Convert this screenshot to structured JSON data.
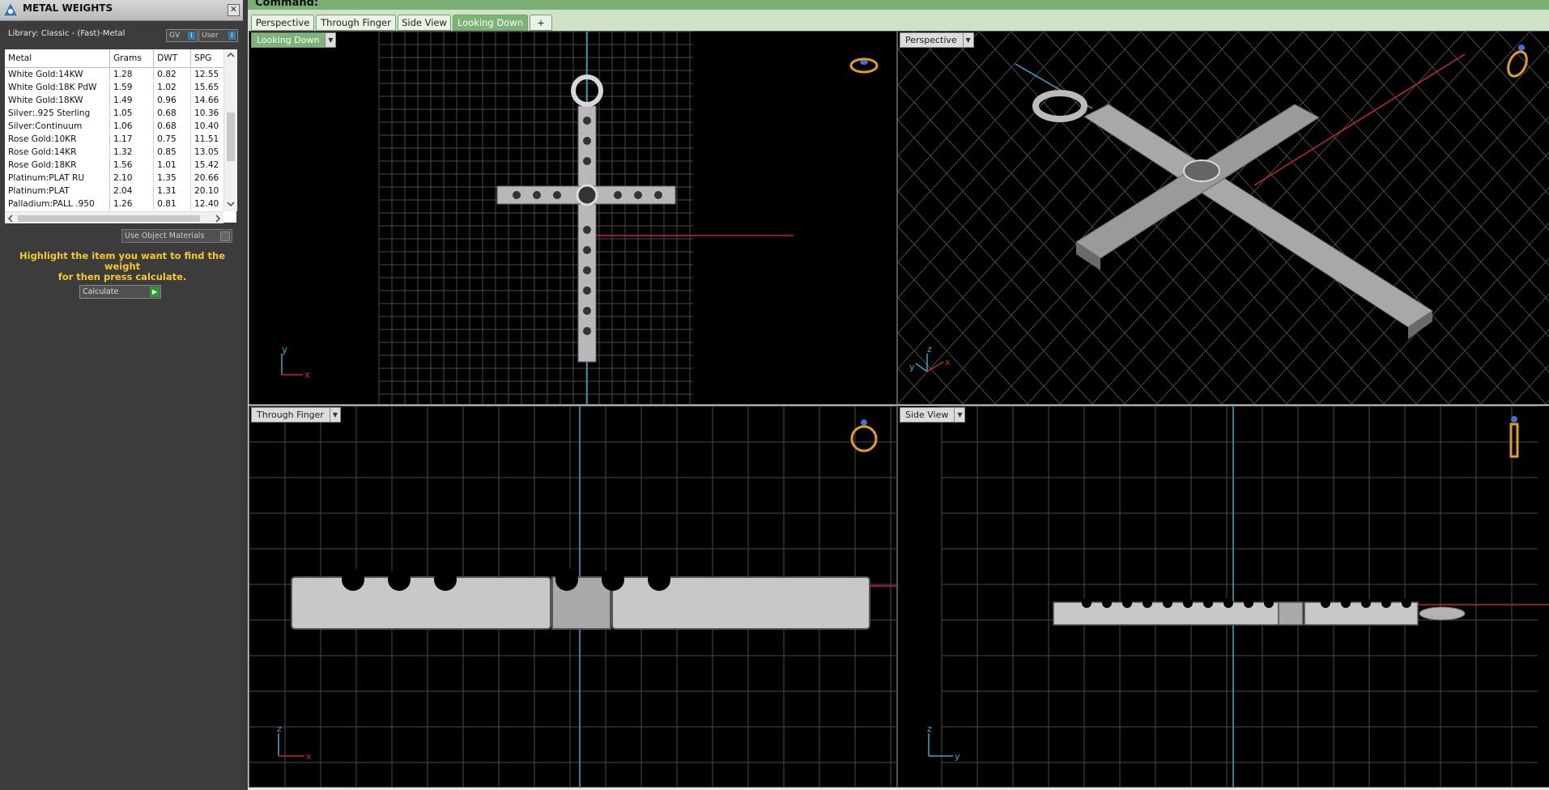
{
  "panel": {
    "title": "METAL WEIGHTS",
    "close": "✕",
    "library": "Library: Classic - (Fast)-Metal",
    "toggle_gv": "GV",
    "toggle_user": "User",
    "toggle_info": "i",
    "columns": [
      "Metal",
      "Grams",
      "DWT",
      "SPG"
    ],
    "rows": [
      [
        "White Gold:14KW",
        "1.28",
        "0.82",
        "12.55"
      ],
      [
        "White Gold:18K PdW",
        "1.59",
        "1.02",
        "15.65"
      ],
      [
        "White Gold:18KW",
        "1.49",
        "0.96",
        "14.66"
      ],
      [
        "Silver:.925 Sterling",
        "1.05",
        "0.68",
        "10.36"
      ],
      [
        "Silver:Continuum",
        "1.06",
        "0.68",
        "10.40"
      ],
      [
        "Rose Gold:10KR",
        "1.17",
        "0.75",
        "11.51"
      ],
      [
        "Rose Gold:14KR",
        "1.32",
        "0.85",
        "13.05"
      ],
      [
        "Rose Gold:18KR",
        "1.56",
        "1.01",
        "15.42"
      ],
      [
        "Platinum:PLAT RU",
        "2.10",
        "1.35",
        "20.66"
      ],
      [
        "Platinum:PLAT",
        "2.04",
        "1.31",
        "20.10"
      ],
      [
        "Palladium:PALL .950",
        "1.26",
        "0.81",
        "12.40"
      ]
    ],
    "use_object_materials": "Use Object Materials",
    "hint_line1": "Highlight the item you want to find the weight",
    "hint_line2": "for then press calculate.",
    "calculate": "Calculate"
  },
  "command": {
    "label": "Command:"
  },
  "tabs": [
    {
      "label": "Perspective",
      "active": false
    },
    {
      "label": "Through Finger",
      "active": false
    },
    {
      "label": "Side View",
      "active": false
    },
    {
      "label": "Looking Down",
      "active": true
    },
    {
      "label": "+",
      "active": false
    }
  ],
  "viewports": {
    "top_left": {
      "label": "Looking Down",
      "axis_v": "y",
      "axis_h": "x"
    },
    "top_right": {
      "label": "Perspective",
      "axis_v": "z",
      "axis_a": "y",
      "axis_b": "x"
    },
    "bottom_left": {
      "label": "Through Finger",
      "axis_v": "z",
      "axis_h": "x"
    },
    "bottom_right": {
      "label": "Side View",
      "axis_v": "z",
      "axis_h": "y"
    }
  },
  "colors": {
    "accent_green": "#7db376",
    "hint_yellow": "#f5c92a",
    "axis_blue": "#3aa7c9",
    "axis_red": "#c8262a",
    "grid": "#4a4a4a",
    "ring_icon": "#e0a020"
  },
  "icons": [
    "app-logo-icon",
    "close-icon",
    "dropdown-icon",
    "info-icon",
    "play-icon",
    "ring-orientation-icon",
    "axis-triad-icon"
  ]
}
